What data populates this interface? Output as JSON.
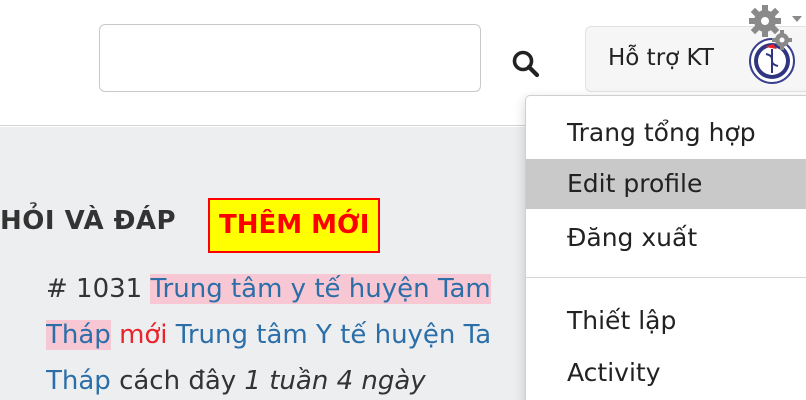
{
  "header": {
    "search": {
      "value": "",
      "placeholder": ""
    },
    "user_name": "Hỗ trợ KT",
    "icons": {
      "search": "search-icon",
      "settings": "gear-icon",
      "avatar": "medical-caduceus-logo"
    }
  },
  "dropdown": {
    "items": [
      {
        "label": "Trang tổng hợp"
      },
      {
        "label": "Edit profile",
        "active": true
      },
      {
        "label": "Đăng xuất"
      },
      {
        "label": "Thiết lập"
      },
      {
        "label": "Activity"
      }
    ]
  },
  "main": {
    "section_title": "HỎI VÀ ĐÁP",
    "add_new_label": "THÊM MỚI",
    "entry": {
      "id_prefix": "# 1031",
      "topic_part1": "Trung tâm y tế huyện Tam",
      "topic_part2": "Tháp",
      "new_label": "mới",
      "author_part1": "Trung tâm Y tế huyện Ta",
      "author_part2": "Tháp",
      "ago": "cách đây",
      "time": "1 tuần 4 ngày"
    }
  },
  "colors": {
    "link": "#2c6fa8",
    "highlight": "#f7c7d3",
    "new_text": "#e8252c",
    "add_button_bg": "#ffff00",
    "add_button_border": "#ff0000",
    "menu_active": "#c9c9c9",
    "content_bg": "#edeef0"
  }
}
